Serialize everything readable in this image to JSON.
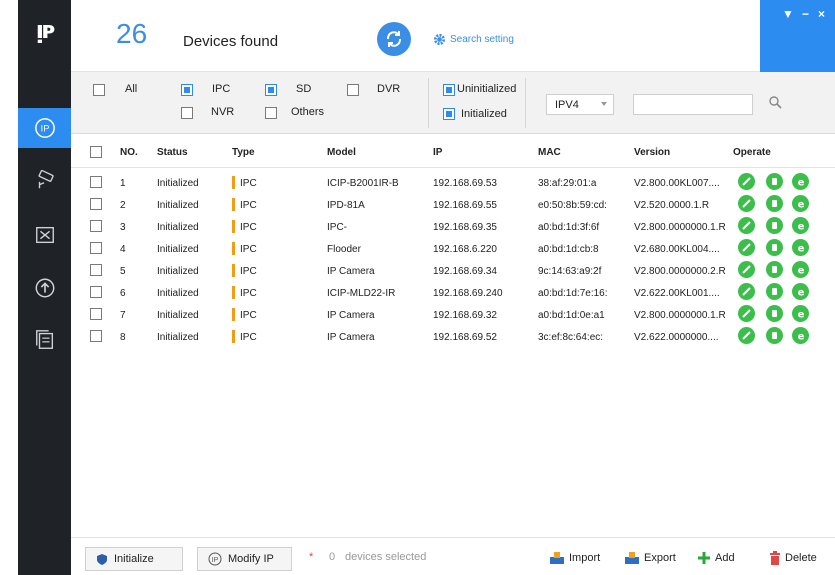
{
  "header": {
    "count": "26",
    "found_label": "Devices found",
    "search_setting": "Search setting"
  },
  "filters": {
    "all": "All",
    "ipc": "IPC",
    "sd": "SD",
    "dvr": "DVR",
    "nvr": "NVR",
    "others": "Others",
    "uninitialized": "Uninitialized",
    "initialized": "Initialized",
    "ip_version": "IPV4",
    "search_value": ""
  },
  "table": {
    "headers": [
      "NO.",
      "Status",
      "Type",
      "Model",
      "IP",
      "MAC",
      "Version",
      "Operate"
    ],
    "rows": [
      {
        "no": "1",
        "status": "Initialized",
        "type": "IPC",
        "model": "ICIP-B2001IR-B",
        "ip": "192.168.69.53",
        "mac": "38:af:29:01:a",
        "version": "V2.800.00KL007...."
      },
      {
        "no": "2",
        "status": "Initialized",
        "type": "IPC",
        "model": "IPD-81A",
        "ip": "192.168.69.55",
        "mac": "e0:50:8b:59:cd:",
        "version": "V2.520.0000.1.R"
      },
      {
        "no": "3",
        "status": "Initialized",
        "type": "IPC",
        "model": "IPC-",
        "ip": "192.168.69.35",
        "mac": "a0:bd:1d:3f:6f",
        "version": "V2.800.0000000.1.R"
      },
      {
        "no": "4",
        "status": "Initialized",
        "type": "IPC",
        "model": "Flooder",
        "ip": "192.168.6.220",
        "mac": "a0:bd:1d:cb:8",
        "version": "V2.680.00KL004...."
      },
      {
        "no": "5",
        "status": "Initialized",
        "type": "IPC",
        "model": "IP Camera",
        "ip": "192.168.69.34",
        "mac": "9c:14:63:a9:2f",
        "version": "V2.800.0000000.2.R"
      },
      {
        "no": "6",
        "status": "Initialized",
        "type": "IPC",
        "model": "ICIP-MLD22-IR",
        "ip": "192.168.69.240",
        "mac": "a0:bd:1d:7e:16:",
        "version": "V2.622.00KL001...."
      },
      {
        "no": "7",
        "status": "Initialized",
        "type": "IPC",
        "model": "IP Camera",
        "ip": "192.168.69.32",
        "mac": "a0:bd:1d:0e:a1",
        "version": "V2.800.0000000.1.R"
      },
      {
        "no": "8",
        "status": "Initialized",
        "type": "IPC",
        "model": "IP Camera",
        "ip": "192.168.69.52",
        "mac": "3c:ef:8c:64:ec:",
        "version": "V2.622.0000000...."
      }
    ]
  },
  "footer": {
    "initialize": "Initialize",
    "modify_ip": "Modify IP",
    "star": "*",
    "selected_count": "0",
    "selected_label": "devices selected",
    "import": "Import",
    "export": "Export",
    "add": "Add",
    "delete": "Delete"
  },
  "colors": {
    "accent": "#2d8cf0",
    "type_marker": "#f39c12",
    "operate": "#3bbf4a",
    "sidebar": "#1f2227"
  },
  "icons": [
    "logo-icon",
    "ip-icon",
    "camera-icon",
    "tools-icon",
    "upgrade-icon",
    "docs-icon",
    "refresh-icon",
    "gear-icon",
    "search-icon",
    "edit-icon",
    "web-icon",
    "browser-icon",
    "shield-icon",
    "import-icon",
    "export-icon",
    "add-icon",
    "delete-icon"
  ]
}
